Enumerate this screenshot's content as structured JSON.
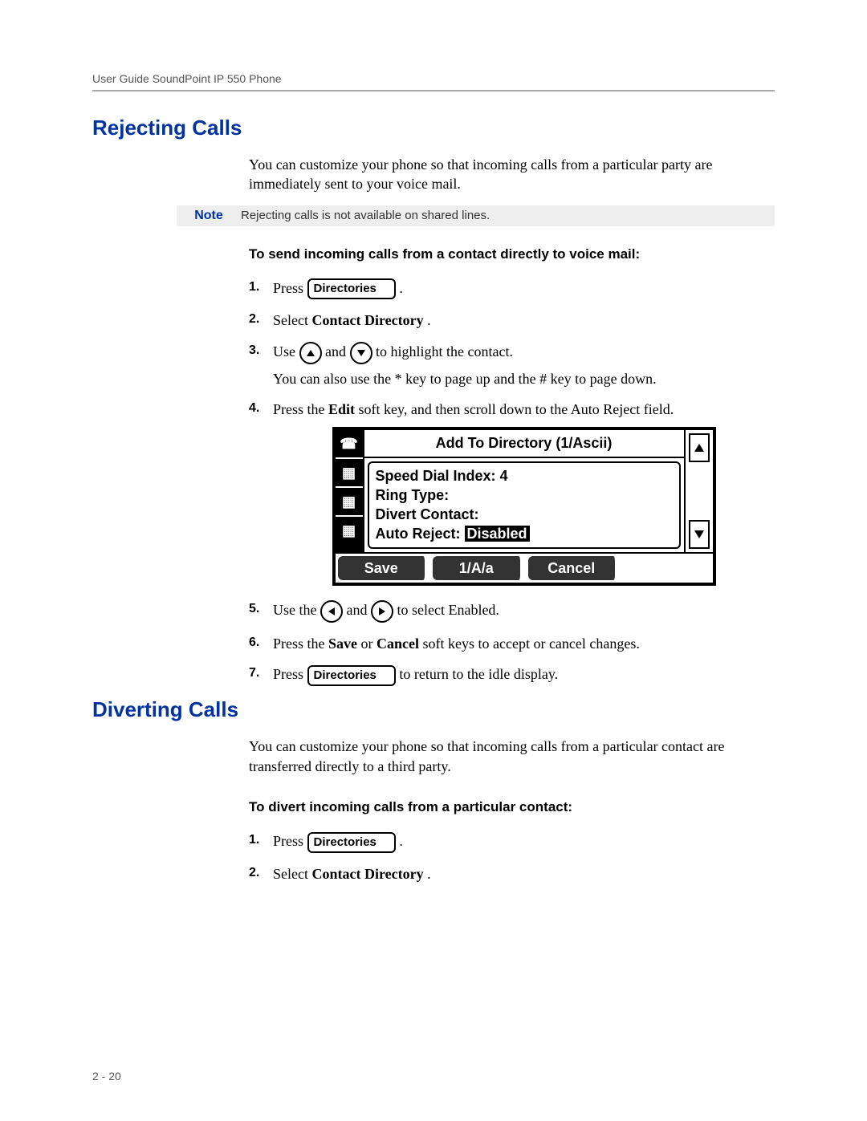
{
  "header": "User Guide SoundPoint IP 550 Phone",
  "page_number": "2 - 20",
  "rejecting": {
    "title": "Rejecting Calls",
    "intro": "You can customize your phone so that incoming calls from a particular party are immediately sent to your voice mail.",
    "note_label": "Note",
    "note_text": "Rejecting calls is not available on shared lines.",
    "subhead": "To send incoming calls from a contact directly to voice mail:",
    "steps": {
      "s1_a": "Press ",
      "dir_btn": "Directories",
      "s1_b": " .",
      "s2_a": "Select ",
      "s2_b": "Contact Directory",
      "s2_c": ".",
      "s3_a": "Use  ",
      "s3_b": " and  ",
      "s3_c": " to highlight the contact.",
      "s3_sub": "You can also use the * key to page up and the # key to page down.",
      "s4_a": "Press the ",
      "s4_b": "Edit",
      "s4_c": " soft key, and then scroll down to the Auto Reject field.",
      "s5_a": "Use the  ",
      "s5_b": "  and ",
      "s5_c": "  to select Enabled.",
      "s6_a": "Press the ",
      "s6_b": "Save",
      "s6_c": " or ",
      "s6_d": "Cancel",
      "s6_e": " soft keys to accept or cancel changes.",
      "s7_a": "Press  ",
      "s7_b": "  to return to the idle display."
    },
    "lcd": {
      "title": "Add To Directory (1/Ascii)",
      "line1": "Speed Dial Index: 4",
      "line2": "Ring Type:",
      "line3": "Divert Contact:",
      "line4_label": "Auto Reject:",
      "line4_value": "Disabled",
      "soft1": "Save",
      "soft2": "1/A/a",
      "soft3": "Cancel",
      "soft4": ""
    }
  },
  "diverting": {
    "title": "Diverting Calls",
    "intro": "You can customize your phone so that incoming calls from a particular contact are transferred directly to a third party.",
    "subhead": "To divert incoming calls from a particular contact:",
    "steps": {
      "s1_a": "Press ",
      "dir_btn": "Directories",
      "s1_b": " .",
      "s2_a": "Select ",
      "s2_b": "Contact Directory",
      "s2_c": "."
    }
  }
}
